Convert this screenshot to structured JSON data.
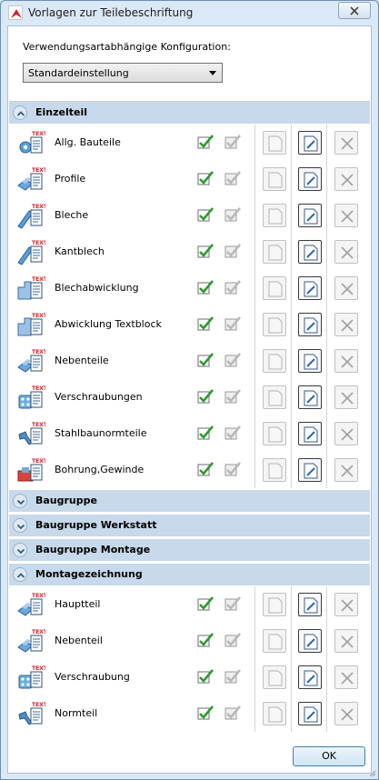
{
  "window": {
    "title": "Vorlagen zur Teilebeschriftung"
  },
  "config": {
    "label": "Verwendungsartabhängige Konfiguration:",
    "value": "Standardeinstellung"
  },
  "icons": {
    "text_tag": "TEXT"
  },
  "groups": {
    "einzelteil": "Einzelteil",
    "baugruppe": "Baugruppe",
    "baugruppe_werkstatt": "Baugruppe Werkstatt",
    "baugruppe_montage": "Baugruppe Montage",
    "montagezeichnung": "Montagezeichnung"
  },
  "einzelteil_items": [
    {
      "label": "Allg. Bauteile",
      "icon": "gear-part-icon"
    },
    {
      "label": "Profile",
      "icon": "profile-icon"
    },
    {
      "label": "Bleche",
      "icon": "sheet-icon"
    },
    {
      "label": "Kantblech",
      "icon": "bent-sheet-icon"
    },
    {
      "label": "Blechabwicklung",
      "icon": "sheet-unfold-icon"
    },
    {
      "label": "Abwicklung Textblock",
      "icon": "unfold-textblock-icon"
    },
    {
      "label": "Nebenteile",
      "icon": "secondary-part-icon"
    },
    {
      "label": "Verschraubungen",
      "icon": "bolting-icon"
    },
    {
      "label": "Stahlbaunormteile",
      "icon": "standard-part-icon"
    },
    {
      "label": "Bohrung,Gewinde",
      "icon": "drilling-icon"
    }
  ],
  "montage_items": [
    {
      "label": "Hauptteil",
      "icon": "main-part-icon"
    },
    {
      "label": "Nebenteil",
      "icon": "secondary-part-icon"
    },
    {
      "label": "Verschraubung",
      "icon": "bolting-icon"
    },
    {
      "label": "Normteil",
      "icon": "standard-part-icon"
    }
  ],
  "colors": {
    "group_band": "#c7d9ea",
    "check_green": "#2e9a2e"
  },
  "ok_label": "OK"
}
